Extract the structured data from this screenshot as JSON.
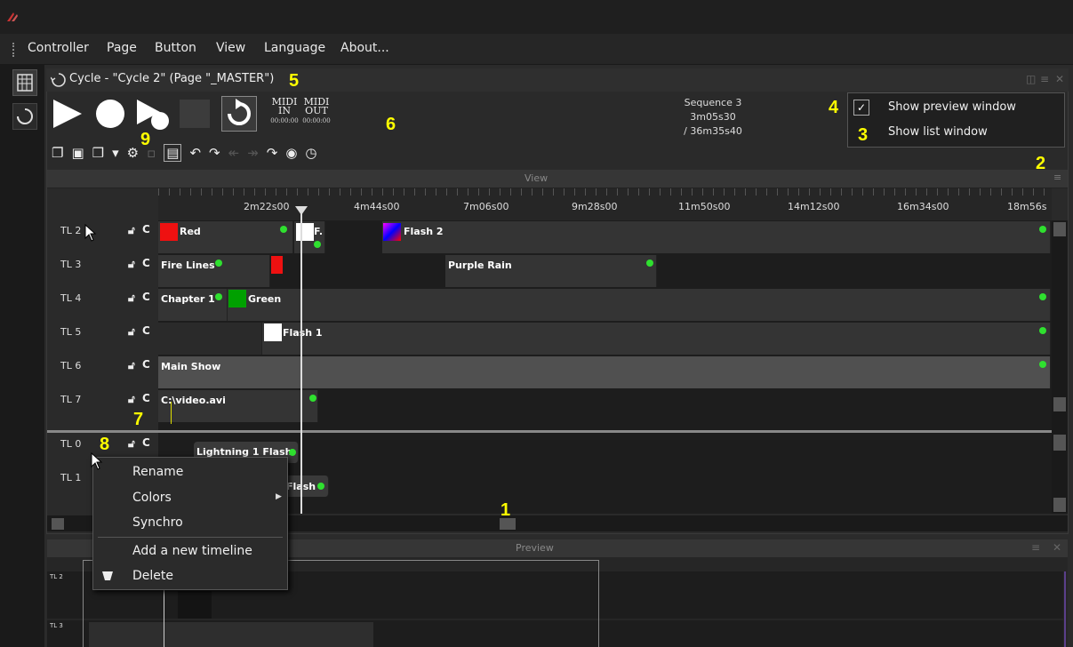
{
  "menu": [
    "Controller",
    "Page",
    "Button",
    "View",
    "Language",
    "About..."
  ],
  "cycle_window": {
    "title": "Cycle - \"Cycle 2\" (Page \"_MASTER\")",
    "sequence": "Sequence 3",
    "elapsed": "3m05s30",
    "total": "/ 36m35s40",
    "midi_in": "MIDI IN",
    "midi_out": "MIDI OUT",
    "midi_in_time": "00:00:00",
    "midi_out_time": "00:00:00"
  },
  "options": {
    "preview": "Show preview window",
    "list": "Show list window",
    "preview_checked": true
  },
  "view_title": "View",
  "preview_title": "Preview",
  "ruler_ticks": [
    "2m22s00",
    "4m44s00",
    "7m06s00",
    "9m28s00",
    "11m50s00",
    "14m12s00",
    "16m34s00",
    "18m56s"
  ],
  "timelines": [
    {
      "label": "TL 2"
    },
    {
      "label": "TL 3"
    },
    {
      "label": "TL 4"
    },
    {
      "label": "TL 5"
    },
    {
      "label": "TL 6"
    },
    {
      "label": "TL 7"
    },
    {
      "label": "TL 0"
    },
    {
      "label": "TL 1"
    }
  ],
  "clips": {
    "red": "Red",
    "f_short": "F.",
    "flash2": "Flash 2",
    "fire_lines": "Fire Lines",
    "purple_rain": "Purple Rain",
    "chapter1": "Chapter 1",
    "green": "Green",
    "flash1": "Flash 1",
    "main_show": "Main Show",
    "video": "C:\\video.avi",
    "lightning": "Lightning 1 Flash",
    "flash_tl1": "Flash"
  },
  "context_menu": [
    "Rename",
    "Colors",
    "Synchro",
    "Add a new timeline",
    "Delete"
  ],
  "preview_rows": [
    "TL 2",
    "TL 3"
  ],
  "callouts": [
    "1",
    "2",
    "3",
    "4",
    "5",
    "6",
    "7",
    "8",
    "9"
  ],
  "colors": {
    "accent_green": "#2fe02f",
    "callout_yellow": "#ffff00",
    "red_clip": "#ee1111",
    "green_clip": "#00a000"
  }
}
